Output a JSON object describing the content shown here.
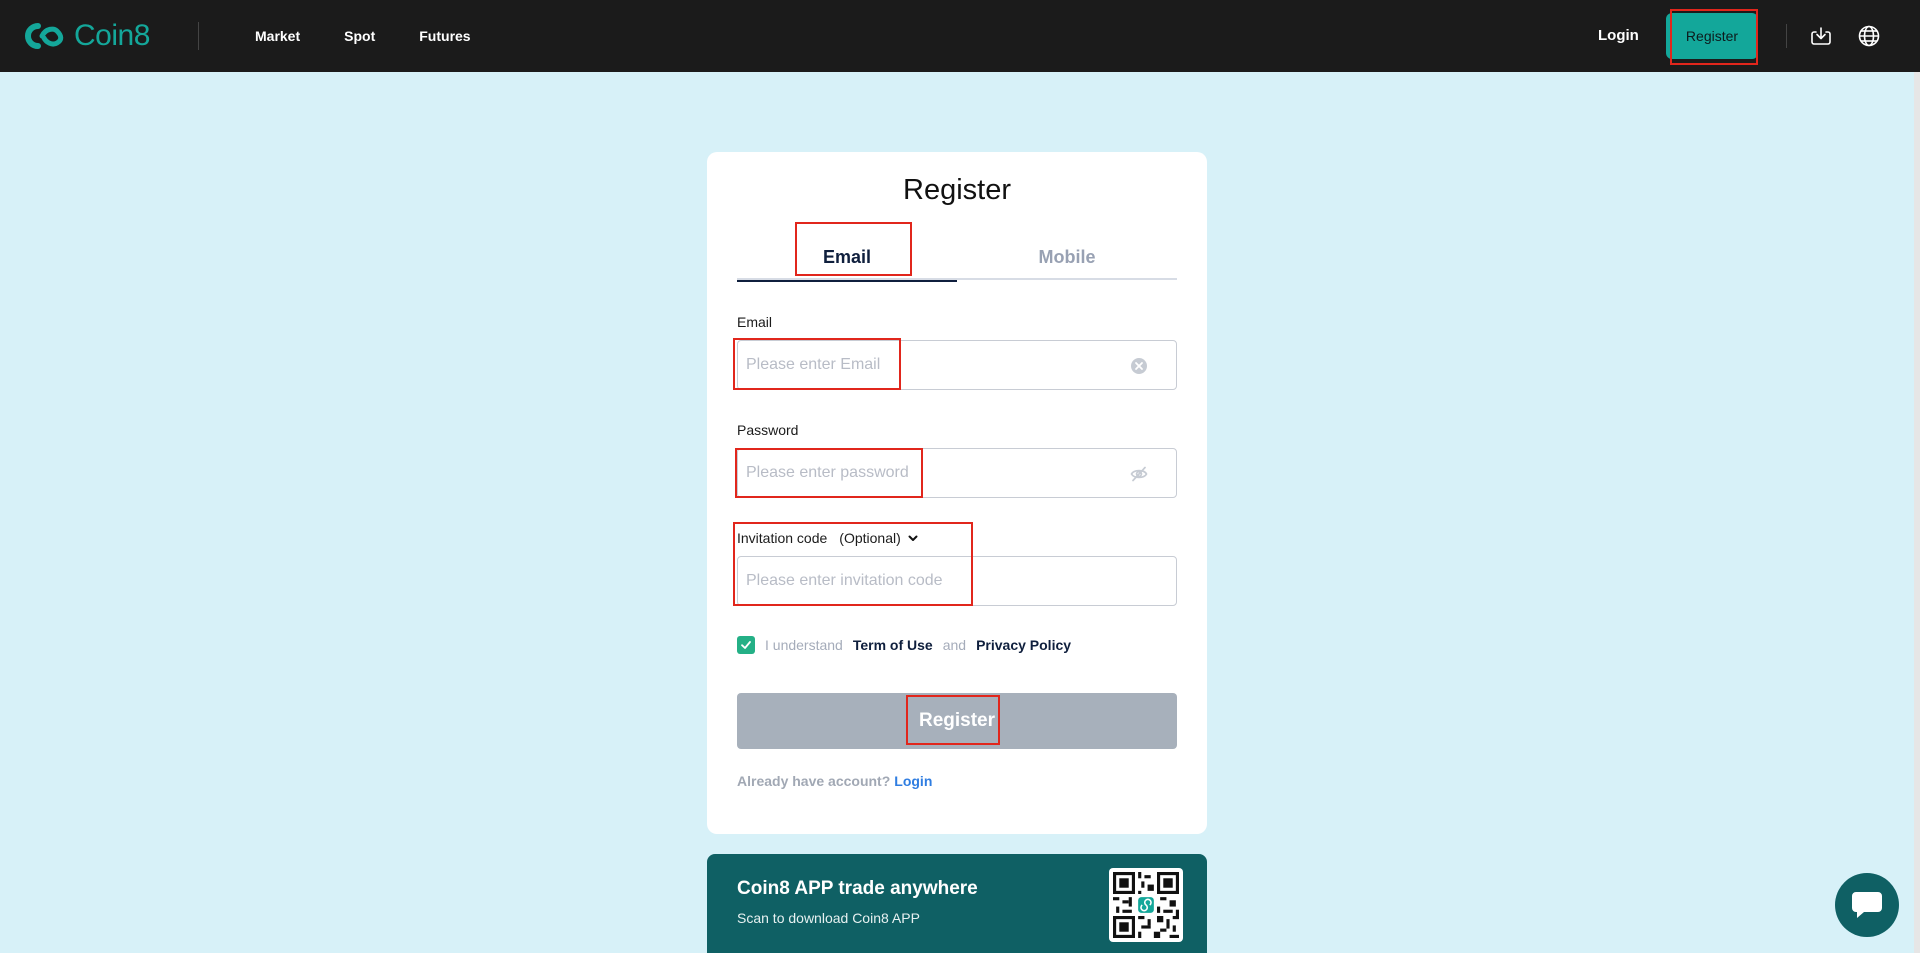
{
  "header": {
    "brand": "Coin8",
    "nav": [
      "Market",
      "Spot",
      "Futures"
    ],
    "login": "Login",
    "register": "Register",
    "accent": "#13a79a",
    "icons": [
      "download-icon",
      "globe-icon"
    ]
  },
  "form": {
    "title": "Register",
    "tabs": {
      "email": "Email",
      "mobile": "Mobile",
      "active": "Email"
    },
    "email": {
      "label": "Email",
      "placeholder": "Please enter Email"
    },
    "password": {
      "label": "Password",
      "placeholder": "Please enter password"
    },
    "invitation": {
      "label": "Invitation code",
      "optional": "(Optional)",
      "placeholder": "Please enter invitation code"
    },
    "agree": {
      "prefix": "I understand",
      "terms": "Term of Use",
      "and": "and",
      "privacy": "Privacy Policy",
      "checked": true
    },
    "submit": "Register",
    "have_account": "Already have account?",
    "login_link": "Login"
  },
  "app_banner": {
    "title": "Coin8 APP trade anywhere",
    "subtitle": "Scan to download Coin8 APP"
  }
}
